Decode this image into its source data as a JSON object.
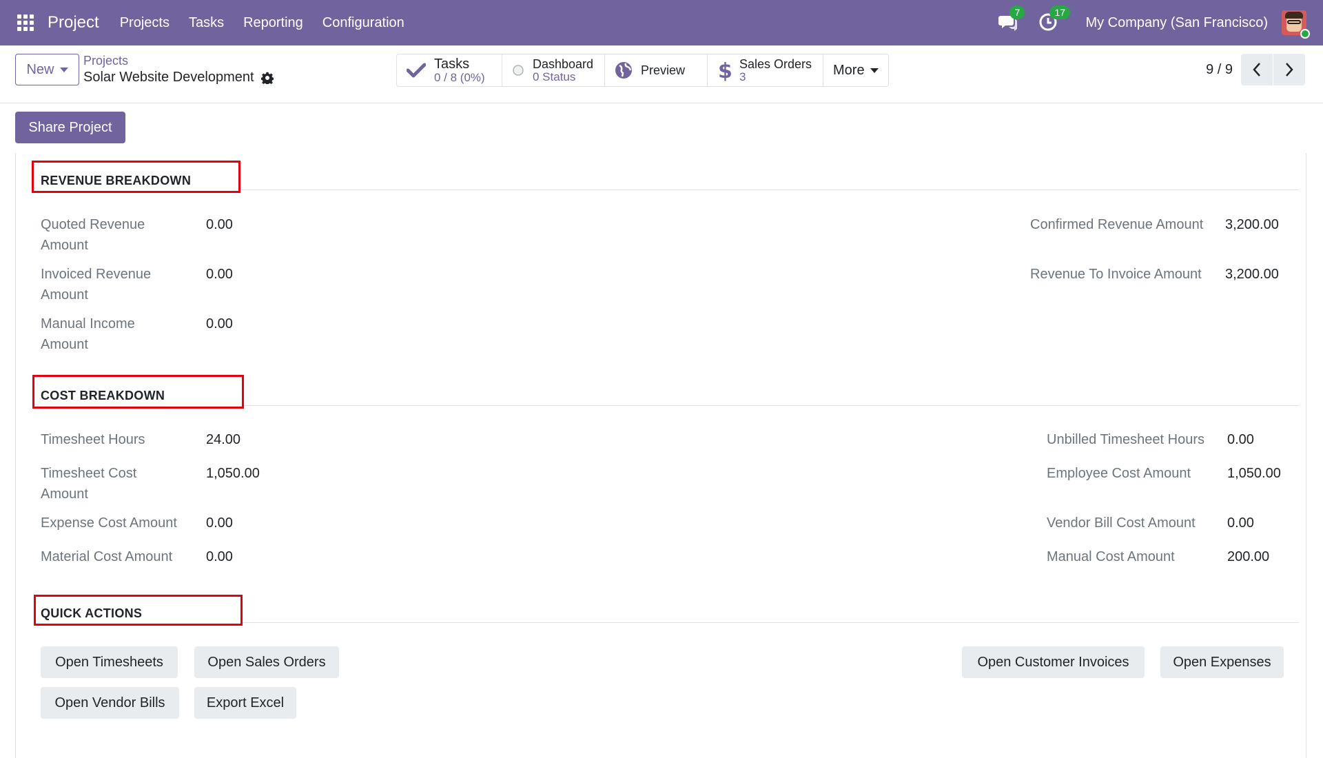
{
  "navbar": {
    "app_name": "Project",
    "menu": [
      "Projects",
      "Tasks",
      "Reporting",
      "Configuration"
    ],
    "messages_count": "7",
    "activities_count": "17",
    "company": "My Company (San Francisco)",
    "bg_color": "#71639e"
  },
  "control_panel": {
    "new_label": "New",
    "breadcrumb_parent": "Projects",
    "breadcrumb_current": "Solar Website Development",
    "stats": {
      "tasks_title": "Tasks",
      "tasks_value": "0 / 8 (0%)",
      "dashboard_title": "Dashboard",
      "dashboard_value": "0 Status",
      "preview_title": "Preview",
      "sales_title": "Sales Orders",
      "sales_value": "3",
      "more_label": "More"
    },
    "pager": "9 / 9"
  },
  "share_button": "Share Project",
  "revenue": {
    "title": "REVENUE BREAKDOWN",
    "left": [
      {
        "label_line1": "Quoted Revenue",
        "label_line2": "Amount",
        "value": "0.00"
      },
      {
        "label_line1": "Invoiced Revenue",
        "label_line2": "Amount",
        "value": "0.00"
      },
      {
        "label_line1": "Manual Income",
        "label_line2": "Amount",
        "value": "0.00"
      }
    ],
    "right": [
      {
        "label": "Confirmed Revenue Amount",
        "value": "3,200.00"
      },
      {
        "label": "Revenue To Invoice Amount",
        "value": "3,200.00"
      }
    ]
  },
  "cost": {
    "title": "COST BREAKDOWN",
    "left": [
      {
        "label": "Timesheet Hours",
        "value": "24.00"
      },
      {
        "label_line1": "Timesheet Cost",
        "label_line2": "Amount",
        "value": "1,050.00"
      },
      {
        "label": "Expense Cost Amount",
        "value": "0.00"
      },
      {
        "label": "Material Cost Amount",
        "value": "0.00"
      }
    ],
    "right": [
      {
        "label": "Unbilled Timesheet Hours",
        "value": "0.00"
      },
      {
        "label": "Employee Cost Amount",
        "value": "1,050.00"
      },
      {
        "label": "Vendor Bill Cost Amount",
        "value": "0.00"
      },
      {
        "label": "Manual Cost Amount",
        "value": "200.00"
      }
    ]
  },
  "quick_actions": {
    "title": "QUICK ACTIONS",
    "buttons": [
      "Open Timesheets",
      "Open Sales Orders",
      "Open Customer Invoices",
      "Open Expenses",
      "Open Vendor Bills",
      "Export Excel"
    ]
  },
  "icons": {
    "apps": "apps-grid-icon",
    "messages": "chat-icon",
    "activities": "clock-icon",
    "tasks": "check-icon",
    "dashboard": "radio-circle-icon",
    "preview": "globe-icon",
    "sales": "dollar-icon",
    "settings": "gear-icon"
  },
  "colors": {
    "primary": "#71639e",
    "highlight_box": "#e3000f",
    "badge": "#28a745"
  }
}
